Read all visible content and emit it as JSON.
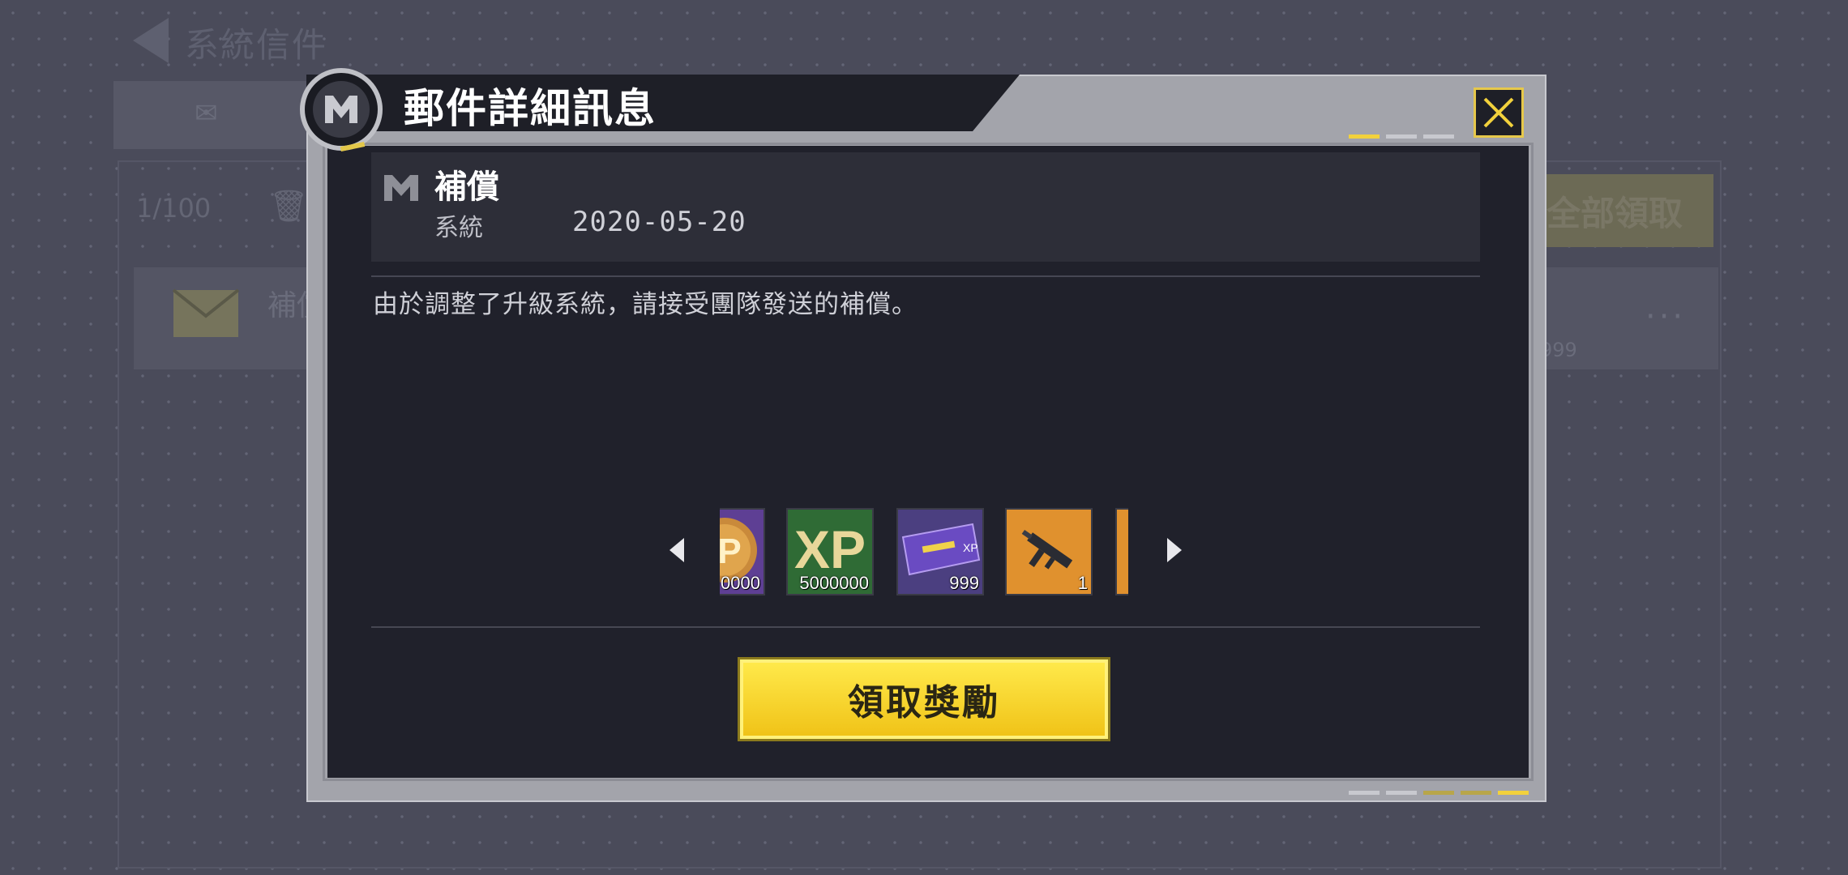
{
  "background": {
    "screen_title": "系統信件",
    "count": "1/100",
    "claim_all_label": "全部領取",
    "row_title": "補償",
    "row_item_count": "999"
  },
  "modal": {
    "title": "郵件詳細訊息",
    "mail": {
      "subject": "補償",
      "sender": "系統",
      "date": "2020-05-20",
      "message": "由於調整了升級系統，請接受團隊發送的補償。"
    },
    "rewards": [
      {
        "icon": "cp-coin-icon",
        "count": "0000"
      },
      {
        "icon": "xp-icon",
        "count": "5000000"
      },
      {
        "icon": "weapon-xp-card-icon",
        "count": "999"
      },
      {
        "icon": "smg-weapon-icon",
        "count": "1"
      }
    ],
    "claim_label": "領取獎勵"
  },
  "colors": {
    "accent_yellow": "#f5d22a",
    "panel_dark": "#20212b",
    "frame_grey": "#a3a4ab"
  }
}
